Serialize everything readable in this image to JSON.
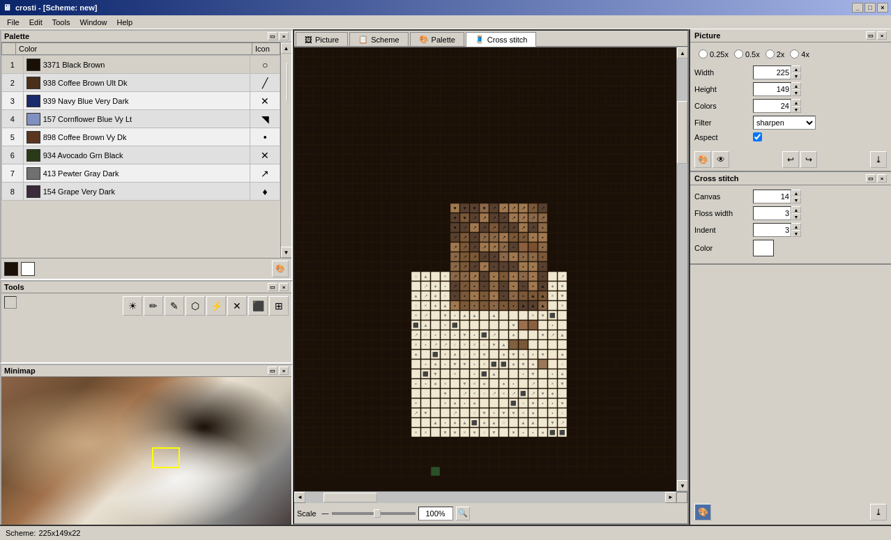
{
  "titleBar": {
    "title": "crosti - [Scheme: new]",
    "buttons": [
      "_",
      "□",
      "×"
    ]
  },
  "menuBar": {
    "items": [
      "File",
      "Edit",
      "Tools",
      "Window",
      "Help"
    ]
  },
  "palette": {
    "title": "Palette",
    "headers": [
      "",
      "Color",
      "Icon"
    ],
    "rows": [
      {
        "num": 1,
        "color": "#1a1008",
        "name": "3371 Black Brown",
        "icon": "○"
      },
      {
        "num": 2,
        "color": "#4a2f1a",
        "name": "938 Coffee Brown Ult Dk",
        "icon": "/"
      },
      {
        "num": 3,
        "color": "#1a2a6b",
        "name": "939 Navy Blue Very Dark",
        "icon": "✕↗"
      },
      {
        "num": 4,
        "color": "#8090c0",
        "name": "157 Cornflower Blue Vy Lt",
        "icon": "◥"
      },
      {
        "num": 5,
        "color": "#5a3520",
        "name": "898 Coffee Brown Vy Dk",
        "icon": "•"
      },
      {
        "num": 6,
        "color": "#2a3a18",
        "name": "934 Avocado Grn Black",
        "icon": "✕↗"
      },
      {
        "num": 7,
        "color": "#707070",
        "name": "413 Pewter Gray Dark",
        "icon": "↗"
      },
      {
        "num": 8,
        "color": "#3a2a3a",
        "name": "154 Grape Very Dark",
        "icon": "♦"
      }
    ]
  },
  "tools": {
    "title": "Tools",
    "buttons": [
      "☀",
      "✏",
      "✎",
      "⬡",
      "⚡",
      "✕",
      "⬛",
      "⊞"
    ]
  },
  "minimap": {
    "title": "Minimap"
  },
  "tabs": [
    {
      "id": "picture",
      "label": "Picture",
      "icon": "🖼"
    },
    {
      "id": "scheme",
      "label": "Scheme",
      "icon": "📋"
    },
    {
      "id": "palette-tab",
      "label": "Palette",
      "icon": "🎨"
    },
    {
      "id": "crossstitch",
      "label": "Cross stitch",
      "icon": "🧵",
      "active": true
    }
  ],
  "picture": {
    "title": "Picture",
    "zoom": {
      "options": [
        "0.25x",
        "0.5x",
        "2x",
        "4x"
      ],
      "selected": "0.25x"
    },
    "width": {
      "label": "Width",
      "value": "225"
    },
    "height": {
      "label": "Height",
      "value": "149"
    },
    "colors": {
      "label": "Colors",
      "value": "24"
    },
    "filter": {
      "label": "Filter",
      "value": "sharpen"
    },
    "aspect": {
      "label": "Aspect",
      "checked": true
    }
  },
  "crossstitch": {
    "title": "Cross stitch",
    "canvas": {
      "label": "Canvas",
      "value": "14"
    },
    "flossWidth": {
      "label": "Floss width",
      "value": "3"
    },
    "indent": {
      "label": "Indent",
      "value": "3"
    },
    "color": {
      "label": "Color",
      "value": ""
    }
  },
  "scale": {
    "label": "Scale",
    "value": "100%"
  },
  "statusBar": {
    "scheme": "Scheme:",
    "dimensions": "225x149x22"
  }
}
